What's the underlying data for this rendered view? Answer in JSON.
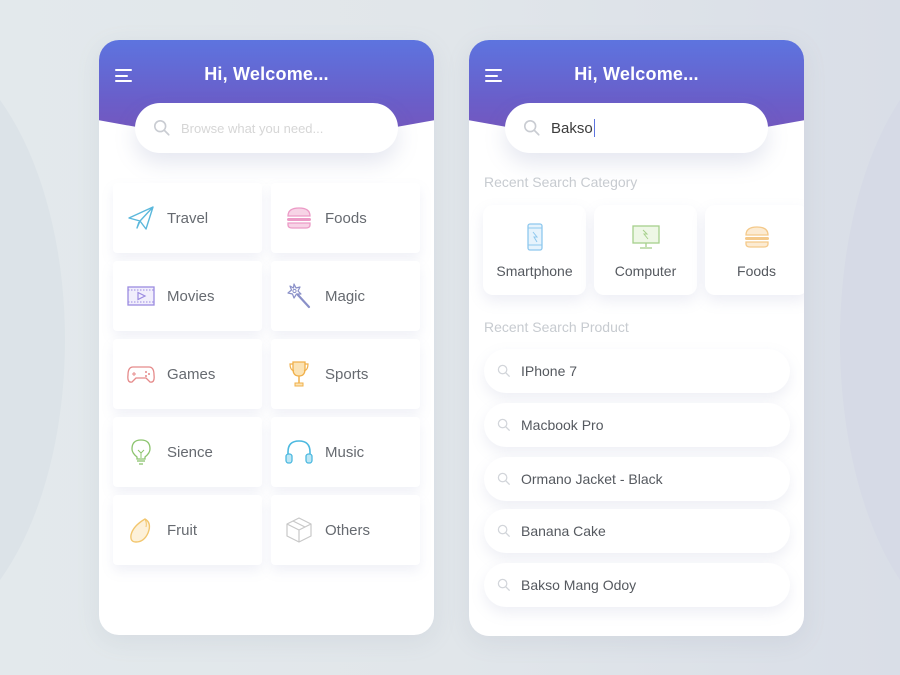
{
  "colors": {
    "header_top": "#5d74df",
    "header_bottom": "#7a53b8",
    "accent": "#5d74df"
  },
  "left_screen": {
    "header": {
      "menu_icon": "hamburger-menu-icon",
      "title": "Hi, Welcome..."
    },
    "search": {
      "icon": "search-icon",
      "placeholder": "Browse what you need..."
    },
    "categories": [
      {
        "label": "Travel",
        "icon": "paper-plane-icon",
        "color": "#5bb8dc"
      },
      {
        "label": "Foods",
        "icon": "burger-icon",
        "color": "#ec9ac6"
      },
      {
        "label": "Movies",
        "icon": "film-play-icon",
        "color": "#9b8be0"
      },
      {
        "label": "Magic",
        "icon": "magic-wand-icon",
        "color": "#8a90c8"
      },
      {
        "label": "Games",
        "icon": "gamepad-icon",
        "color": "#e58a8a"
      },
      {
        "label": "Sports",
        "icon": "trophy-icon",
        "color": "#f0b04a"
      },
      {
        "label": "Sience",
        "icon": "light-bulb-icon",
        "color": "#8cc46e"
      },
      {
        "label": "Music",
        "icon": "headphones-icon",
        "color": "#4cb9e0"
      },
      {
        "label": "Fruit",
        "icon": "mango-icon",
        "color": "#f2c66e"
      },
      {
        "label": "Others",
        "icon": "box-icon",
        "color": "#c8c8c8"
      }
    ]
  },
  "right_screen": {
    "header": {
      "menu_icon": "hamburger-menu-icon",
      "title": "Hi, Welcome..."
    },
    "search": {
      "icon": "search-icon",
      "value": "Bakso"
    },
    "recent_category_label": "Recent Search Category",
    "recent_categories": [
      {
        "label": "Smartphone",
        "icon": "smartphone-icon",
        "color": "#8ec8ee"
      },
      {
        "label": "Computer",
        "icon": "monitor-icon",
        "color": "#a6d08c"
      },
      {
        "label": "Foods",
        "icon": "burger-icon",
        "color": "#f4c98a"
      }
    ],
    "recent_product_label": "Recent Search Product",
    "recent_products": [
      {
        "label": "IPhone 7",
        "icon": "search-icon"
      },
      {
        "label": "Macbook Pro",
        "icon": "search-icon"
      },
      {
        "label": "Ormano Jacket - Black",
        "icon": "search-icon"
      },
      {
        "label": "Banana Cake",
        "icon": "search-icon"
      },
      {
        "label": "Bakso Mang Odoy",
        "icon": "search-icon"
      }
    ]
  }
}
